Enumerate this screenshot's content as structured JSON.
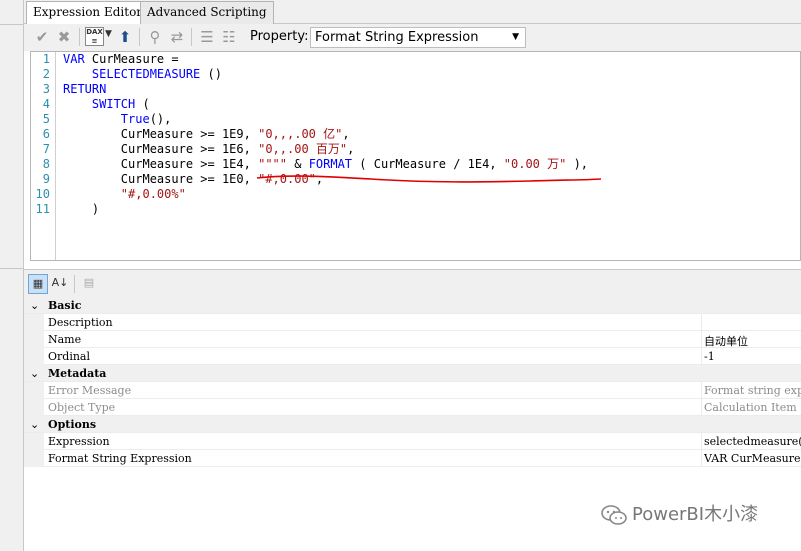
{
  "tabs": [
    {
      "label": "Expression Editor",
      "active": true
    },
    {
      "label": "Advanced Scripting",
      "active": false
    }
  ],
  "toolbar": {
    "icons": [
      "check-icon",
      "cancel-icon",
      "dax-format-icon",
      "dropdown-arrow-icon",
      "deploy-icon",
      "find-icon",
      "replace-icon",
      "comment-icon",
      "uncomment-icon"
    ],
    "dax_badge": "DAX",
    "property_label": "Property:",
    "property_value": "Format String Expression"
  },
  "editor": {
    "line_numbers": [
      "1",
      "2",
      "3",
      "4",
      "5",
      "6",
      "7",
      "8",
      "9",
      "10",
      "11"
    ],
    "lines": [
      [
        {
          "t": "VAR",
          "c": "kw"
        },
        {
          "t": " CurMeasure =",
          "c": "txt"
        }
      ],
      [
        {
          "t": "    ",
          "c": "txt"
        },
        {
          "t": "SELECTEDMEASURE",
          "c": "kw"
        },
        {
          "t": " ()",
          "c": "txt"
        }
      ],
      [
        {
          "t": "RETURN",
          "c": "kw"
        }
      ],
      [
        {
          "t": "    ",
          "c": "txt"
        },
        {
          "t": "SWITCH",
          "c": "kw"
        },
        {
          "t": " (",
          "c": "txt"
        }
      ],
      [
        {
          "t": "        ",
          "c": "txt"
        },
        {
          "t": "True",
          "c": "kw"
        },
        {
          "t": "(),",
          "c": "txt"
        }
      ],
      [
        {
          "t": "        CurMeasure >= ",
          "c": "txt"
        },
        {
          "t": "1E9",
          "c": "txt"
        },
        {
          "t": ", ",
          "c": "txt"
        },
        {
          "t": "\"0,,,.00 亿\"",
          "c": "str"
        },
        {
          "t": ",",
          "c": "txt"
        }
      ],
      [
        {
          "t": "        CurMeasure >= ",
          "c": "txt"
        },
        {
          "t": "1E6",
          "c": "txt"
        },
        {
          "t": ", ",
          "c": "txt"
        },
        {
          "t": "\"0,,.00 百万\"",
          "c": "str"
        },
        {
          "t": ",",
          "c": "txt"
        }
      ],
      [
        {
          "t": "        CurMeasure >= ",
          "c": "txt"
        },
        {
          "t": "1E4",
          "c": "txt"
        },
        {
          "t": ", ",
          "c": "txt"
        },
        {
          "t": "\"\"\"\"",
          "c": "str"
        },
        {
          "t": " & ",
          "c": "txt"
        },
        {
          "t": "FORMAT",
          "c": "kw"
        },
        {
          "t": " ( CurMeasure / ",
          "c": "txt"
        },
        {
          "t": "1E4",
          "c": "txt"
        },
        {
          "t": ", ",
          "c": "txt"
        },
        {
          "t": "\"0.00 万\"",
          "c": "str"
        },
        {
          "t": " ),",
          "c": "txt"
        }
      ],
      [
        {
          "t": "        CurMeasure >= ",
          "c": "txt"
        },
        {
          "t": "1E0",
          "c": "txt"
        },
        {
          "t": ", ",
          "c": "txt"
        },
        {
          "t": "\"#,0.00\"",
          "c": "str"
        },
        {
          "t": ",",
          "c": "txt"
        }
      ],
      [
        {
          "t": "        ",
          "c": "txt"
        },
        {
          "t": "\"#,0.00%\"",
          "c": "str"
        }
      ],
      [
        {
          "t": "    )",
          "c": "txt"
        }
      ]
    ],
    "annotation_color": "#e00000"
  },
  "properties_toolbar": {
    "buttons": [
      "categorized-icon",
      "alphabetical-icon",
      "property-pages-icon"
    ]
  },
  "grid": [
    {
      "type": "category",
      "label": "Basic"
    },
    {
      "type": "prop",
      "label": "Description",
      "value": ""
    },
    {
      "type": "prop",
      "label": "Name",
      "value": "自动单位"
    },
    {
      "type": "prop",
      "label": "Ordinal",
      "value": "-1"
    },
    {
      "type": "category",
      "label": "Metadata"
    },
    {
      "type": "prop",
      "label": "Error Message",
      "value": "Format string exp",
      "disabled": true
    },
    {
      "type": "prop",
      "label": "Object Type",
      "value": "Calculation Item",
      "disabled": true
    },
    {
      "type": "category",
      "label": "Options"
    },
    {
      "type": "prop",
      "label": "Expression",
      "value": "selectedmeasure("
    },
    {
      "type": "prop",
      "label": "Format String Expression",
      "value": "VAR CurMeasure ="
    }
  ],
  "watermark": "PowerBI木小漆"
}
